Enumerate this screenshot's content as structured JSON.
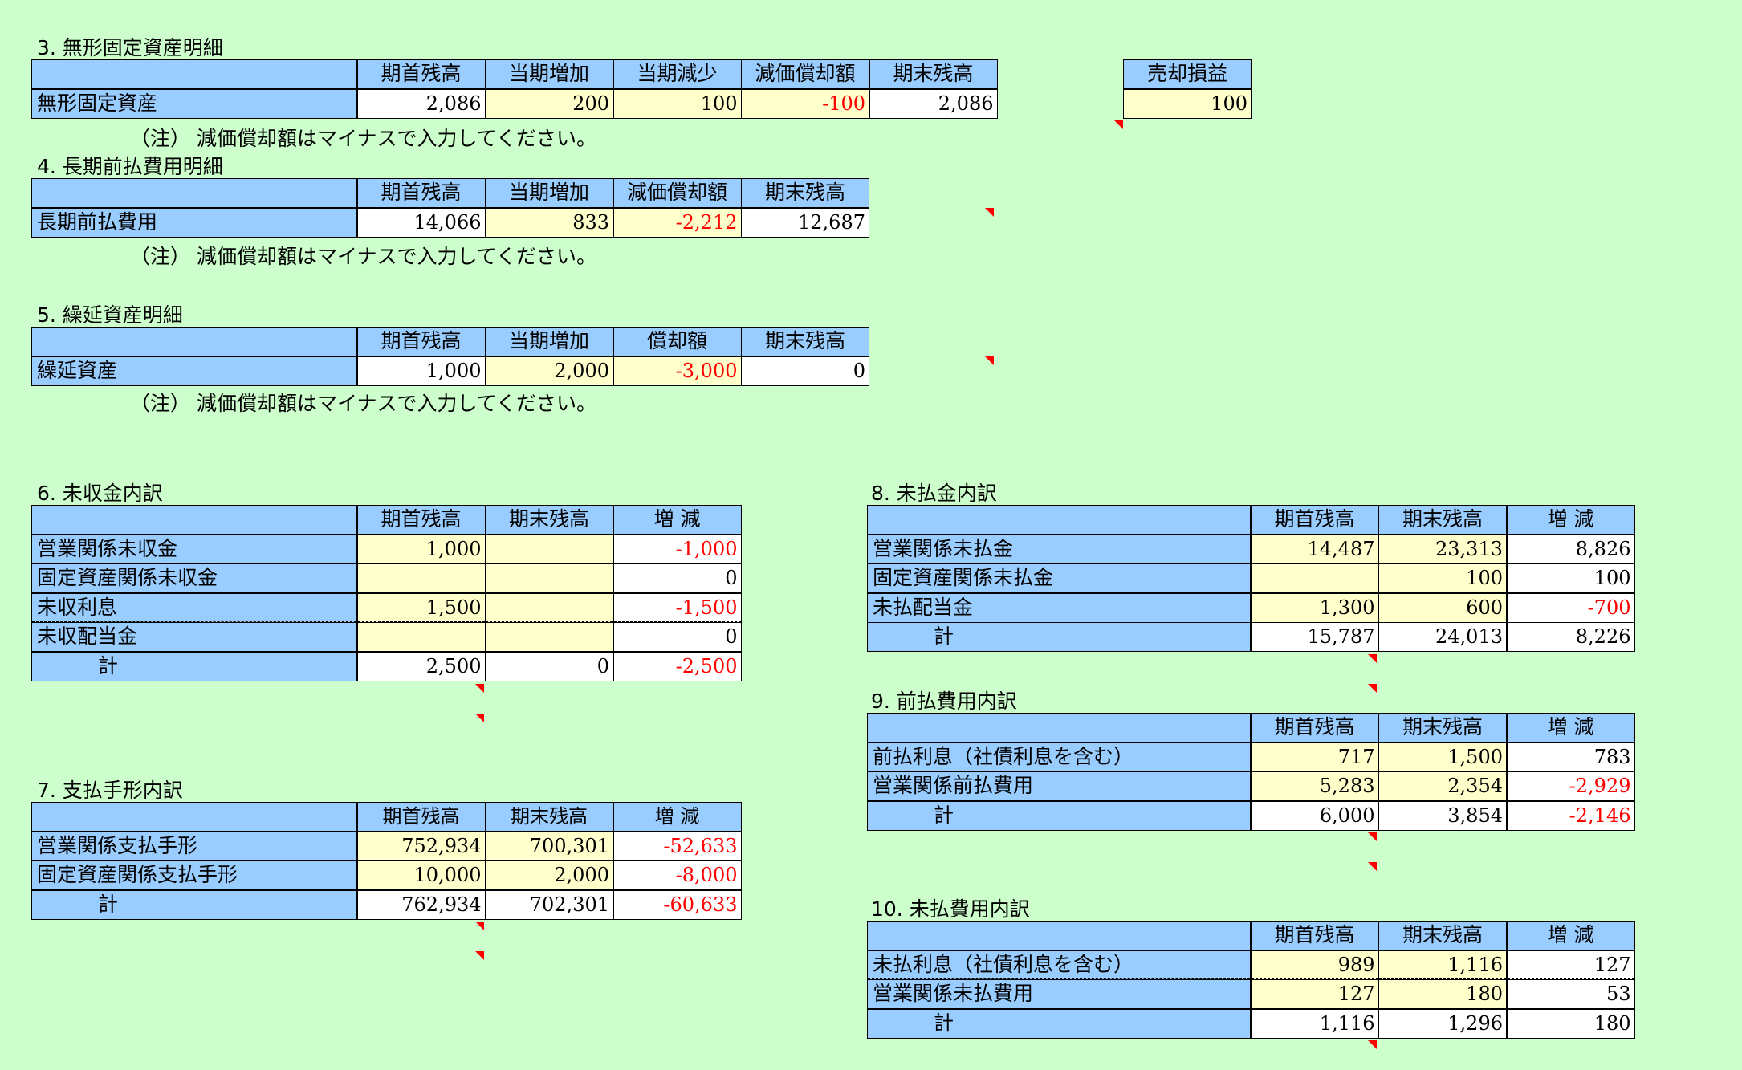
{
  "s3": {
    "title": "3. 無形固定資産明細",
    "headers": [
      "期首残高",
      "当期増加",
      "当期減少",
      "減価償却額",
      "期末残高"
    ],
    "row": {
      "label": "無形固定資産",
      "values": [
        "2,086",
        "200",
        "100",
        "-100",
        "2,086"
      ]
    },
    "sale_header": "売却損益",
    "sale_value": "100",
    "note": "（注） 減価償却額はマイナスで入力してください。"
  },
  "s4": {
    "title": "4. 長期前払費用明細",
    "headers": [
      "期首残高",
      "当期増加",
      "減価償却額",
      "期末残高"
    ],
    "row": {
      "label": "長期前払費用",
      "values": [
        "14,066",
        "833",
        "-2,212",
        "12,687"
      ]
    },
    "note": "（注） 減価償却額はマイナスで入力してください。"
  },
  "s5": {
    "title": "5. 繰延資産明細",
    "headers": [
      "期首残高",
      "当期増加",
      "償却額",
      "期末残高"
    ],
    "row": {
      "label": "繰延資産",
      "values": [
        "1,000",
        "2,000",
        "-3,000",
        "0"
      ]
    },
    "note": "（注） 減価償却額はマイナスで入力してください。"
  },
  "s6": {
    "title": "6. 未収金内訳",
    "headers": [
      "期首残高",
      "期末残高",
      "増 減"
    ],
    "rows": [
      {
        "label": "営業関係未収金",
        "values": [
          "1,000",
          "",
          "-1,000"
        ]
      },
      {
        "label": "固定資産関係未収金",
        "values": [
          "",
          "",
          "0"
        ]
      },
      {
        "label": "未収利息",
        "values": [
          "1,500",
          "",
          "-1,500"
        ]
      },
      {
        "label": "未収配当金",
        "values": [
          "",
          "",
          "0"
        ]
      }
    ],
    "total": {
      "label": "計",
      "values": [
        "2,500",
        "0",
        "-2,500"
      ]
    }
  },
  "s7": {
    "title": "7. 支払手形内訳",
    "headers": [
      "期首残高",
      "期末残高",
      "増 減"
    ],
    "rows": [
      {
        "label": "営業関係支払手形",
        "values": [
          "752,934",
          "700,301",
          "-52,633"
        ]
      },
      {
        "label": "固定資産関係支払手形",
        "values": [
          "10,000",
          "2,000",
          "-8,000"
        ]
      }
    ],
    "total": {
      "label": "計",
      "values": [
        "762,934",
        "702,301",
        "-60,633"
      ]
    }
  },
  "s8": {
    "title": "8. 未払金内訳",
    "headers": [
      "期首残高",
      "期末残高",
      "増 減"
    ],
    "rows": [
      {
        "label": "営業関係未払金",
        "values": [
          "14,487",
          "23,313",
          "8,826"
        ]
      },
      {
        "label": "固定資産関係未払金",
        "values": [
          "",
          "100",
          "100"
        ]
      },
      {
        "label": "未払配当金",
        "values": [
          "1,300",
          "600",
          "-700"
        ]
      }
    ],
    "total": {
      "label": "計",
      "values": [
        "15,787",
        "24,013",
        "8,226"
      ]
    }
  },
  "s9": {
    "title": "9. 前払費用内訳",
    "headers": [
      "期首残高",
      "期末残高",
      "増 減"
    ],
    "rows": [
      {
        "label": "前払利息（社債利息を含む）",
        "values": [
          "717",
          "1,500",
          "783"
        ]
      },
      {
        "label": "営業関係前払費用",
        "values": [
          "5,283",
          "2,354",
          "-2,929"
        ]
      }
    ],
    "total": {
      "label": "計",
      "values": [
        "6,000",
        "3,854",
        "-2,146"
      ]
    }
  },
  "s10": {
    "title": "10. 未払費用内訳",
    "headers": [
      "期首残高",
      "期末残高",
      "増 減"
    ],
    "rows": [
      {
        "label": "未払利息（社債利息を含む）",
        "values": [
          "989",
          "1,116",
          "127"
        ]
      },
      {
        "label": "営業関係未払費用",
        "values": [
          "127",
          "180",
          "53"
        ]
      }
    ],
    "total": {
      "label": "計",
      "values": [
        "1,116",
        "1,296",
        "180"
      ]
    }
  },
  "colors": {
    "background": "#ccffcc",
    "header": "#99ccff",
    "input": "#ffffcc",
    "output": "#ffffff",
    "negative": "#ff0000",
    "comment_marker": "#ff0000"
  }
}
